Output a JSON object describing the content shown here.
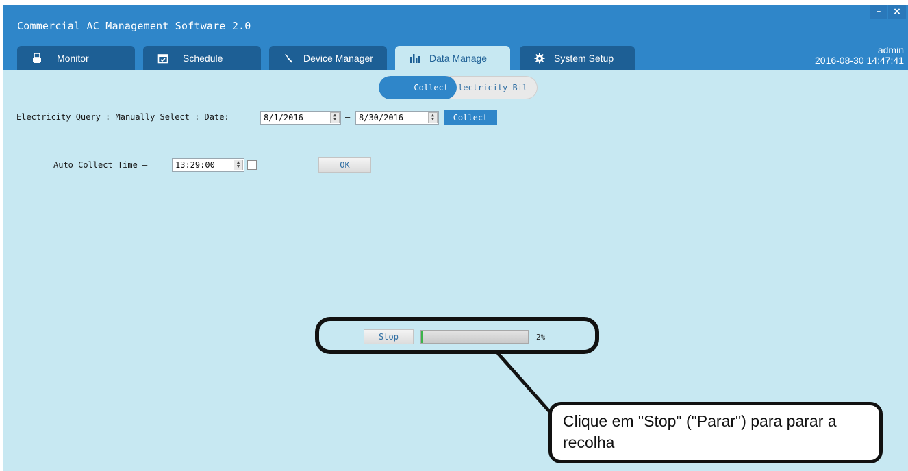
{
  "window": {
    "title": "Commercial AC Management Software 2.0",
    "minimize_label": "–",
    "close_label": "×"
  },
  "tabs": [
    {
      "label": "Monitor",
      "icon": "printer-icon",
      "active": false
    },
    {
      "label": "Schedule",
      "icon": "calendar-icon",
      "active": false
    },
    {
      "label": "Device Manager",
      "icon": "wrench-icon",
      "active": false
    },
    {
      "label": "Data Manage",
      "icon": "bar-chart-icon",
      "active": true
    },
    {
      "label": "System Setup",
      "icon": "gear-icon",
      "active": false
    }
  ],
  "user": {
    "name": "admin",
    "datetime": "2016-08-30 14:47:41"
  },
  "subtabs": {
    "collect": "Collect",
    "electricity_bill": "lectricity Bil"
  },
  "query": {
    "label": "Electricity  Query : Manually  Select : Date:",
    "start_date": "8/1/2016",
    "separator": "–",
    "end_date": "8/30/2016",
    "collect_button": "Collect"
  },
  "auto": {
    "label": "Auto Collect   Time –",
    "time": "13:29:00",
    "checked": false,
    "ok_button": "OK"
  },
  "progress": {
    "stop_button": "Stop",
    "percent": 2,
    "percent_label": "2%"
  },
  "callout": {
    "text": "Clique em \"Stop\" (\"Parar\") para parar a recolha"
  },
  "colors": {
    "header": "#2f86c9",
    "tab": "#1d5f95",
    "background": "#c7e8f2",
    "progress": "#3cb44a"
  }
}
